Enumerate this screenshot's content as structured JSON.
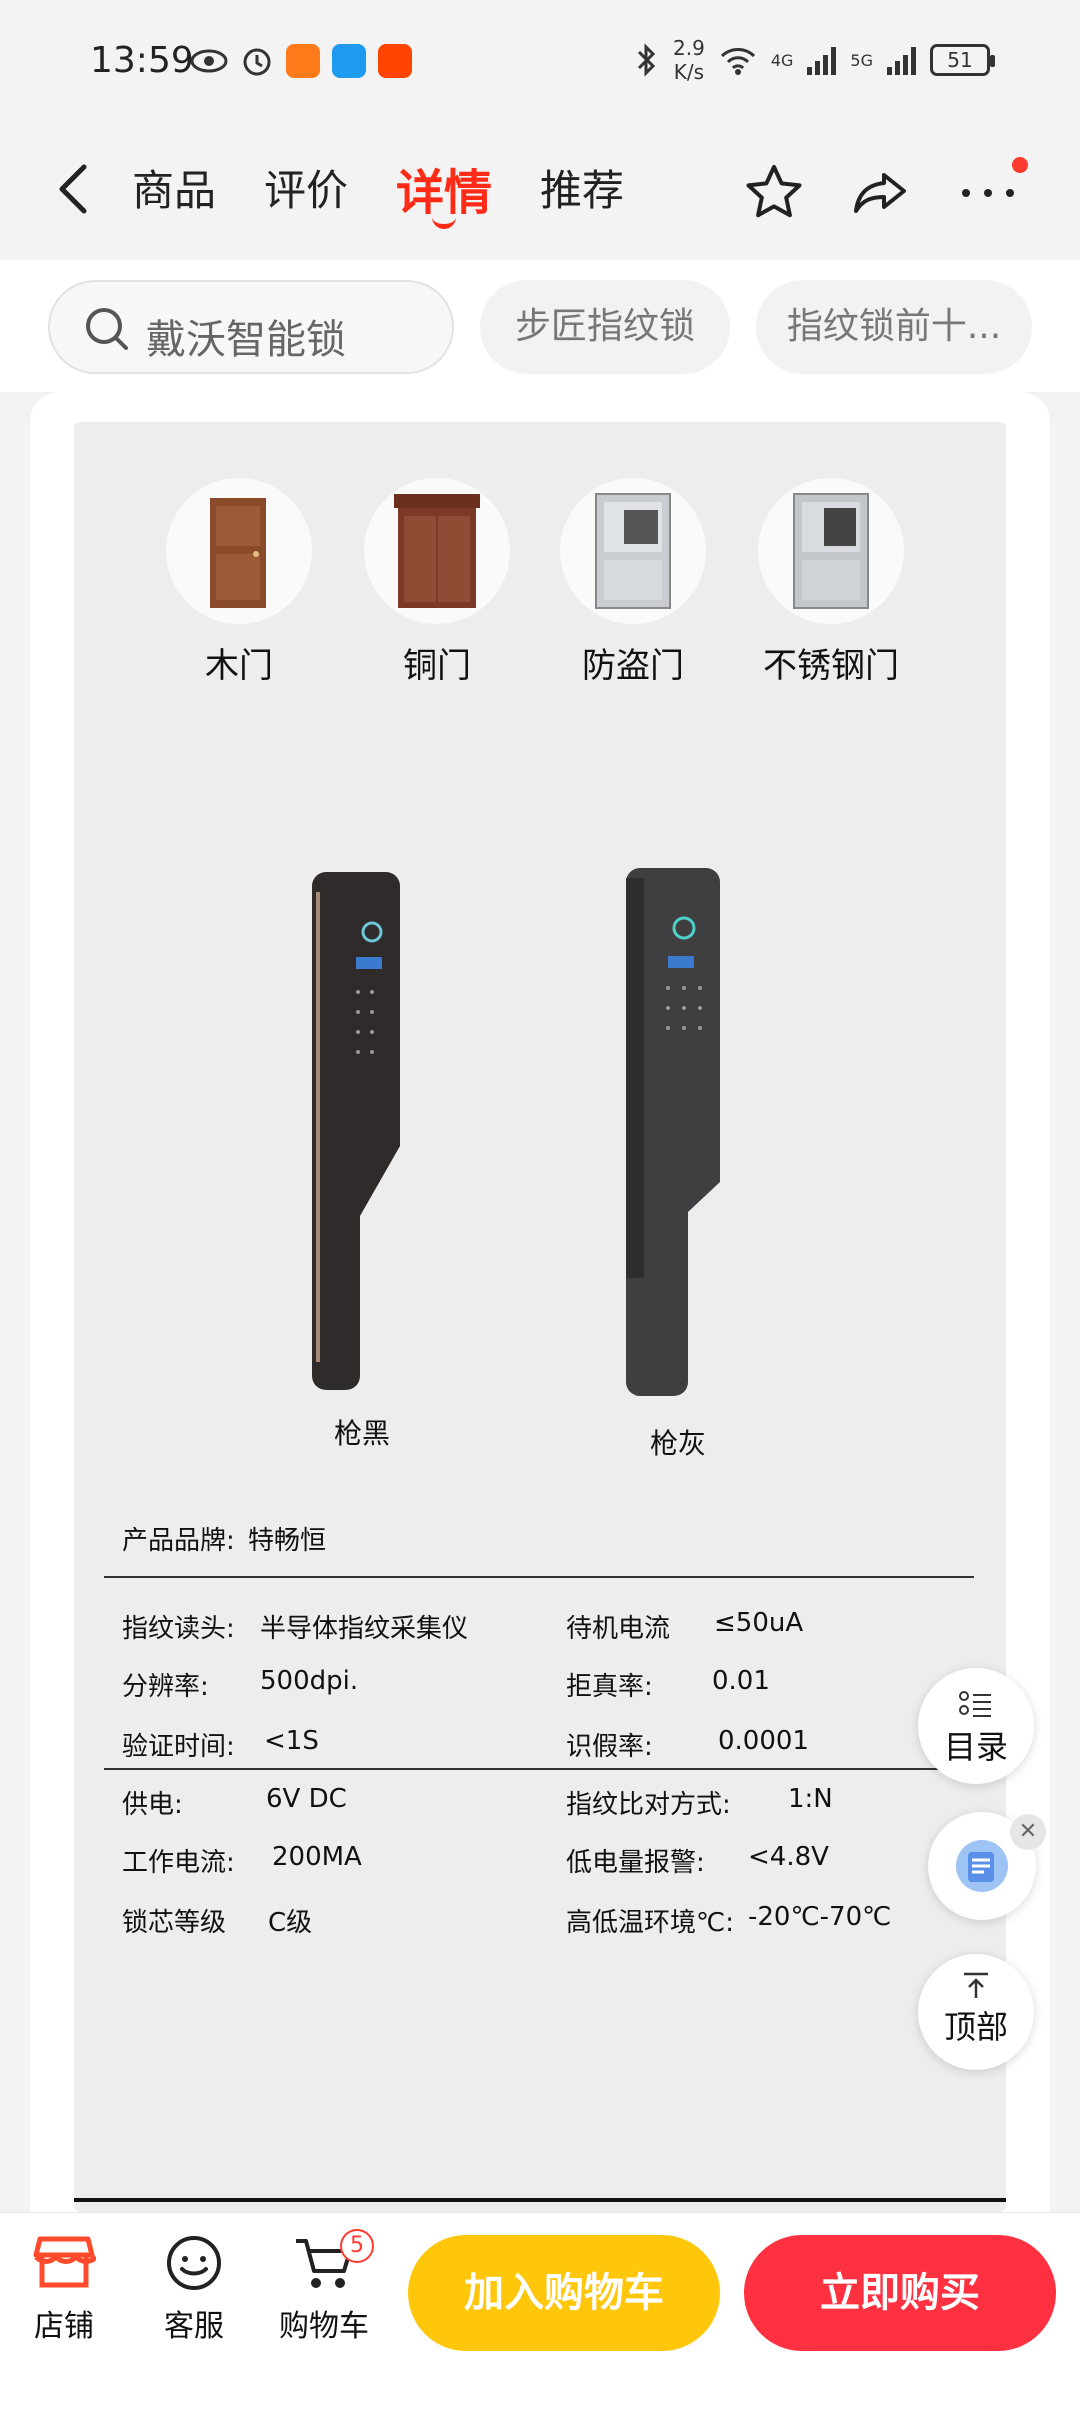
{
  "status_bar": {
    "time": "13:59",
    "speed_value": "2.9",
    "speed_unit": "K/s",
    "network_4g": "4G",
    "network_5g": "5G",
    "battery": "51"
  },
  "nav": {
    "tabs": [
      "商品",
      "评价",
      "详情",
      "推荐"
    ],
    "active_tab": "详情"
  },
  "search": {
    "placeholder": "戴沃智能锁",
    "chips": [
      "步匠指纹锁",
      "指纹锁前十..."
    ]
  },
  "doors": [
    {
      "label": "木门"
    },
    {
      "label": "铜门"
    },
    {
      "label": "防盗门"
    },
    {
      "label": "不锈钢门"
    }
  ],
  "colors": [
    {
      "label": "枪黑",
      "hex": "#2f2b2a"
    },
    {
      "label": "枪灰",
      "hex": "#3f3f42"
    }
  ],
  "specs": {
    "brand_label": "产品品牌:",
    "brand_value": "特畅恒",
    "rows": [
      [
        "指纹读头:",
        "半导体指纹采集仪",
        "待机电流",
        "≤50uA"
      ],
      [
        "分辨率:",
        "500dpi.",
        "拒真率:",
        "0.01"
      ],
      [
        "验证时间:",
        "<1S",
        "识假率:",
        "0.0001"
      ],
      [
        "供电:",
        "6V DC",
        "指纹比对方式:",
        "1:N"
      ],
      [
        "工作电流:",
        "200MA",
        "低电量报警:",
        "<4.8V"
      ],
      [
        "锁芯等级",
        "C级",
        "高低温环境℃:",
        "-20℃-70℃"
      ]
    ]
  },
  "floating": {
    "catalog_label": "目录",
    "top_label": "顶部"
  },
  "bottom_bar": {
    "store": "店铺",
    "service": "客服",
    "cart": "购物车",
    "cart_count": "5",
    "add_to_cart": "加入购物车",
    "buy_now": "立即购买"
  },
  "accent": {
    "red": "#ff2b16",
    "yellow": "#ffc60a",
    "buy": "#ff3141"
  }
}
